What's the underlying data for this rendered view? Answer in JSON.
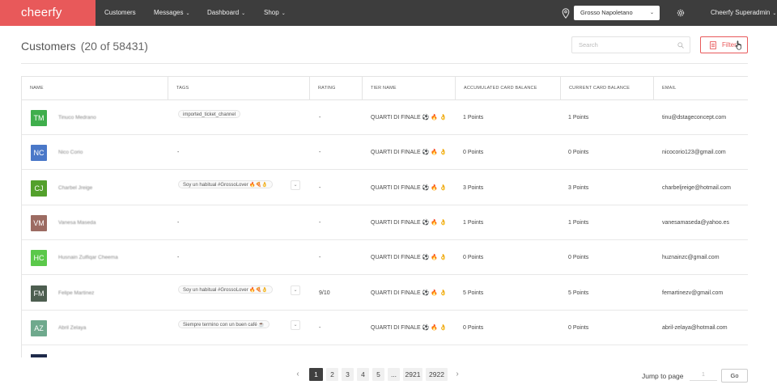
{
  "nav": {
    "brand": "cheerfy",
    "items": [
      {
        "label": "Customers",
        "caret": false
      },
      {
        "label": "Messages",
        "caret": true
      },
      {
        "label": "Dashboard",
        "caret": true
      },
      {
        "label": "Shop",
        "caret": true
      }
    ],
    "store": "Grosso Napoletano",
    "user": "Cheerfy Superadmin"
  },
  "header": {
    "title": "Customers",
    "count": "(20 of 58431)",
    "search_placeholder": "Search",
    "filter_label": "Filter"
  },
  "table": {
    "columns": [
      "NAME",
      "TAGS",
      "RATING",
      "TIER NAME",
      "ACCUMULATED CARD BALANCE",
      "CURRENT CARD BALANCE",
      "EMAIL"
    ],
    "rows": [
      {
        "initials": "TM",
        "color": "#3fae4c",
        "name": "Tinuco Medrano",
        "tag": "imported_ticket_channel",
        "tag_more": false,
        "rating": "-",
        "tier": "QUARTI DI FINALE ⚽ 🔥 👌",
        "accumulated": "1 Points",
        "current": "1 Points",
        "email": "tinu@dstageconcept.com"
      },
      {
        "initials": "NC",
        "color": "#4a78c8",
        "name": "Nico Corio",
        "tag": "-",
        "tag_more": false,
        "rating": "-",
        "tier": "QUARTI DI FINALE ⚽ 🔥 👌",
        "accumulated": "0 Points",
        "current": "0 Points",
        "email": "nicocorio123@gmail.com"
      },
      {
        "initials": "CJ",
        "color": "#53a02c",
        "name": "Charbel Jreige",
        "tag": "Soy un habitual #GrossoLover 🔥🍕👌",
        "tag_more": true,
        "rating": "-",
        "tier": "QUARTI DI FINALE ⚽ 🔥 👌",
        "accumulated": "3 Points",
        "current": "3 Points",
        "email": "charbeljreige@hotmail.com"
      },
      {
        "initials": "VM",
        "color": "#9c6b62",
        "name": "Vanesa Maseda",
        "tag": "-",
        "tag_more": false,
        "rating": "-",
        "tier": "QUARTI DI FINALE ⚽ 🔥 👌",
        "accumulated": "1 Points",
        "current": "1 Points",
        "email": "vanesamaseda@yahoo.es"
      },
      {
        "initials": "HC",
        "color": "#5bc84a",
        "name": "Husnain Zulfiqar Cheema",
        "tag": "-",
        "tag_more": false,
        "rating": "-",
        "tier": "QUARTI DI FINALE ⚽ 🔥 👌",
        "accumulated": "0 Points",
        "current": "0 Points",
        "email": "huznainzc@gmail.com"
      },
      {
        "initials": "FM",
        "color": "#4d5e50",
        "name": "Felipe Martinez",
        "tag": "Soy un habitual #GrossoLover 🔥🍕👌",
        "tag_more": true,
        "rating": "9/10",
        "tier": "QUARTI DI FINALE ⚽ 🔥 👌",
        "accumulated": "5 Points",
        "current": "5 Points",
        "email": "femartinezv@gmail.com"
      },
      {
        "initials": "AZ",
        "color": "#6fa98d",
        "name": "Abril Zelaya",
        "tag": "Siempre termino con un buen café ☕",
        "tag_more": true,
        "rating": "-",
        "tier": "QUARTI DI FINALE ⚽ 🔥 👌",
        "accumulated": "0 Points",
        "current": "0 Points",
        "email": "abril-zelaya@hotmail.com"
      }
    ]
  },
  "pagination": {
    "pages": [
      "1",
      "2",
      "3",
      "4",
      "5",
      "...",
      "2921",
      "2922"
    ],
    "active": "1",
    "jump_label": "Jump to page",
    "jump_value": "1",
    "go_label": "Go"
  },
  "colors": {
    "brand": "#e8595a",
    "nav_bg": "#3d3d3d",
    "active_page": "#3f3f3f"
  }
}
